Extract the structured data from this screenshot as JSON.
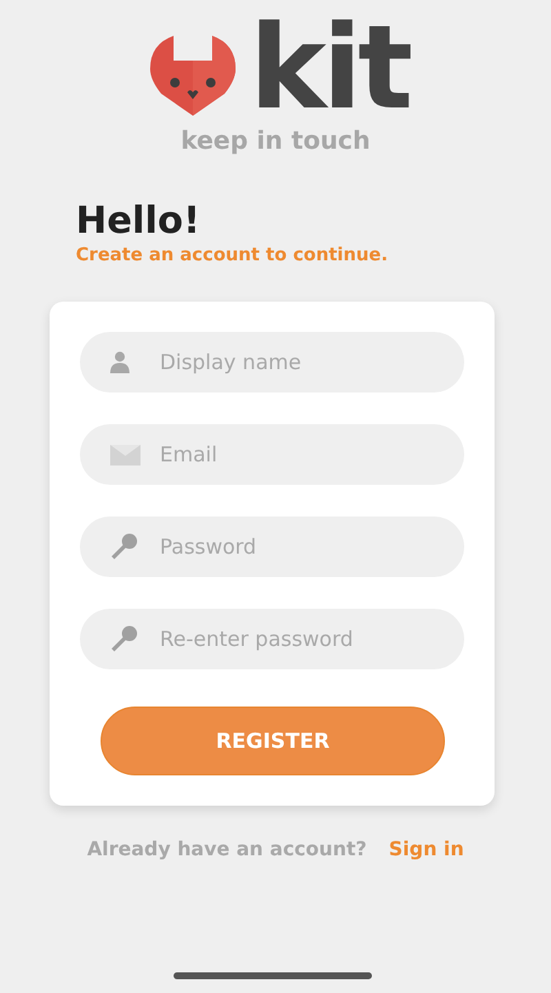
{
  "logo": {
    "wordmark": "kit",
    "tagline": "keep in touch"
  },
  "greeting": {
    "title": "Hello!",
    "subtitle": "Create an account to continue."
  },
  "fields": [
    {
      "kind": "person",
      "placeholder": "Display name"
    },
    {
      "kind": "mail",
      "placeholder": "Email"
    },
    {
      "kind": "key",
      "placeholder": "Password"
    },
    {
      "kind": "key",
      "placeholder": "Re-enter password"
    }
  ],
  "register_button": "REGISTER",
  "footer": {
    "prompt": "Already have an account?",
    "link": "Sign in"
  }
}
